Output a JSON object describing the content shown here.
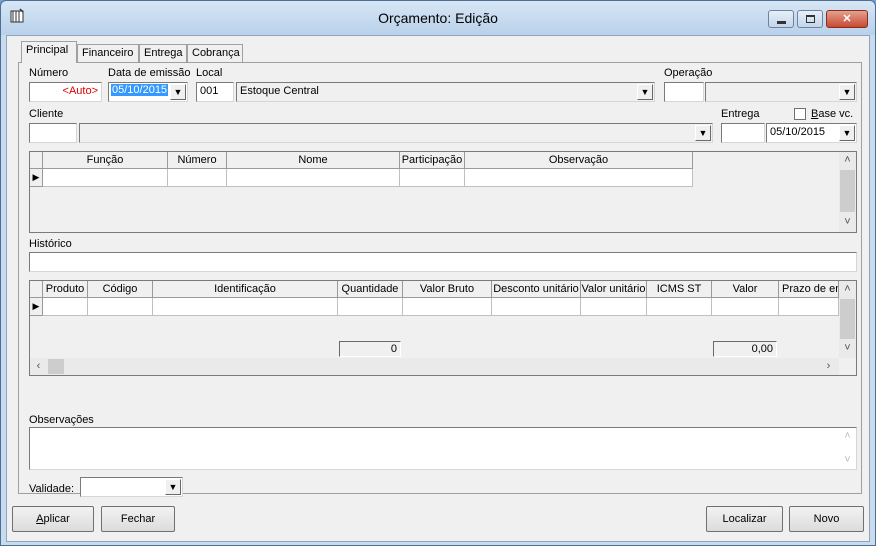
{
  "window": {
    "title": "Orçamento: Edição",
    "minimize": "—",
    "maximize": "□",
    "close": "✕"
  },
  "tabs": [
    "Principal",
    "Financeiro",
    "Entrega",
    "Cobrança"
  ],
  "header": {
    "numero_label": "Número",
    "numero_value": "<Auto>",
    "data_label": "Data de emissão",
    "data_value": "05/10/2015",
    "local_label": "Local",
    "local_code": "001",
    "local_name": "Estoque Central",
    "operacao_label": "Operação",
    "operacao_code": "",
    "operacao_value": "",
    "cliente_label": "Cliente",
    "cliente_code": "",
    "cliente_name": "",
    "entrega_label": "Entrega",
    "entrega_code": "",
    "entrega_date": "05/10/2015",
    "base_label": "Base vc.",
    "base_checked": false
  },
  "participants_grid": {
    "columns": [
      "Função",
      "Número",
      "Nome",
      "Participação",
      "Observação"
    ]
  },
  "historico_label": "Histórico",
  "historico_value": "",
  "items_grid": {
    "columns": [
      "Produto",
      "Código",
      "Identificação",
      "Quantidade",
      "Valor Bruto",
      "Desconto unitário",
      "Valor unitário",
      "ICMS ST",
      "Valor",
      "Prazo de en"
    ],
    "total_quantidade": "0",
    "total_valor": "0,00"
  },
  "observacoes_label": "Observações",
  "observacoes_value": "",
  "validade_label": "Validade:",
  "validade_value": "",
  "buttons": {
    "aplicar": "Aplicar",
    "fechar": "Fechar",
    "localizar": "Localizar",
    "novo": "Novo"
  }
}
